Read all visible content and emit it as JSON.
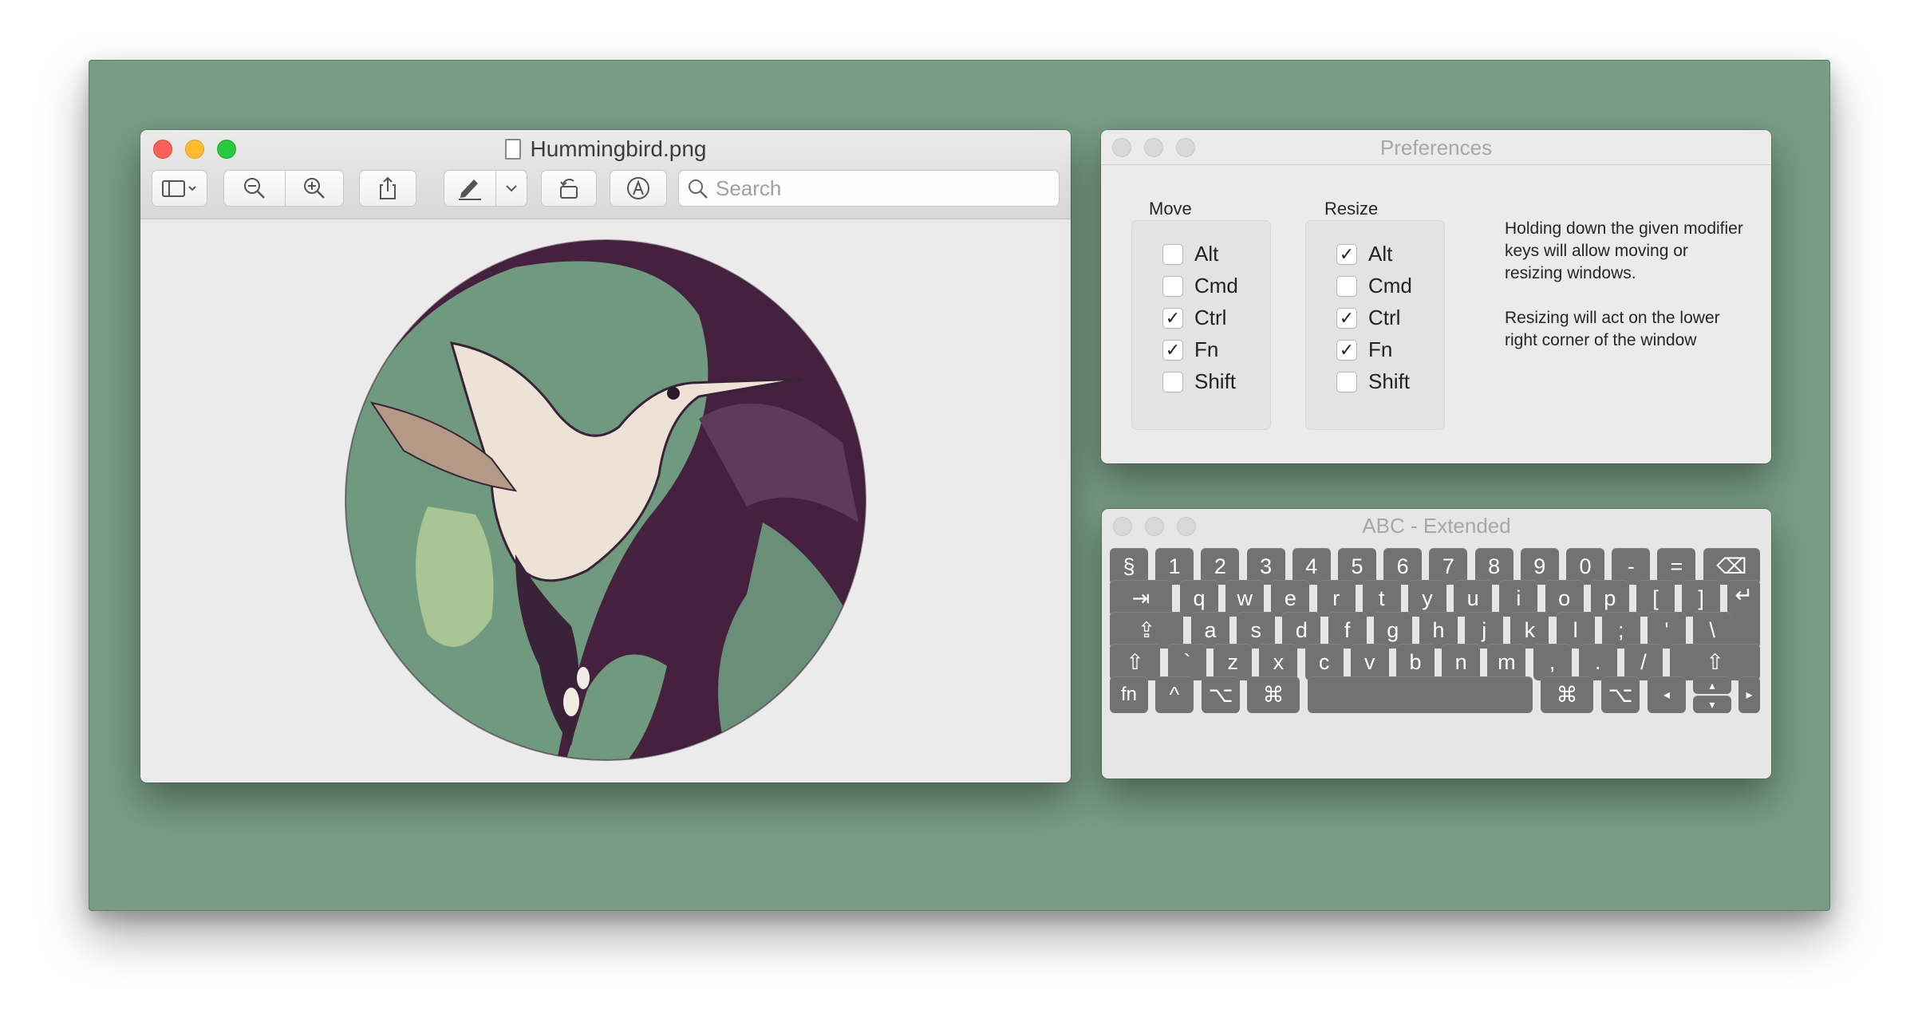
{
  "preview": {
    "title": "Hummingbird.png",
    "search_placeholder": "Search",
    "colors": {
      "disc_dark": "#45213f",
      "disc_green": "#6f9a80",
      "disc_light": "#a9c495",
      "bird_light": "#ece3d6"
    }
  },
  "preferences": {
    "title": "Preferences",
    "move": {
      "label": "Move",
      "options": [
        {
          "label": "Alt",
          "checked": false
        },
        {
          "label": "Cmd",
          "checked": false
        },
        {
          "label": "Ctrl",
          "checked": true
        },
        {
          "label": "Fn",
          "checked": true
        },
        {
          "label": "Shift",
          "checked": false
        }
      ]
    },
    "resize": {
      "label": "Resize",
      "options": [
        {
          "label": "Alt",
          "checked": true
        },
        {
          "label": "Cmd",
          "checked": false
        },
        {
          "label": "Ctrl",
          "checked": true
        },
        {
          "label": "Fn",
          "checked": true
        },
        {
          "label": "Shift",
          "checked": false
        }
      ]
    },
    "description_1": "Holding down the given modifier keys will allow moving or resizing windows.",
    "description_2": "Resizing will act on the lower right corner of the window"
  },
  "keyboard": {
    "title": "ABC - Extended",
    "row1": [
      "§",
      "1",
      "2",
      "3",
      "4",
      "5",
      "6",
      "7",
      "8",
      "9",
      "0",
      "-",
      "=",
      "⌫"
    ],
    "row2": [
      "⇥",
      "q",
      "w",
      "e",
      "r",
      "t",
      "y",
      "u",
      "i",
      "o",
      "p",
      "[",
      "]",
      "↵"
    ],
    "row3": [
      "⇪",
      "a",
      "s",
      "d",
      "f",
      "g",
      "h",
      "j",
      "k",
      "l",
      ";",
      "'",
      "\\"
    ],
    "row4": [
      "⇧",
      "`",
      "z",
      "x",
      "c",
      "v",
      "b",
      "n",
      "m",
      ",",
      ".",
      "/",
      "⇧"
    ],
    "row5": [
      "fn",
      "^",
      "⌥",
      "⌘",
      "",
      "⌘",
      "⌥",
      "◂",
      "▴",
      "▾",
      "▸"
    ]
  },
  "desktop_color": "#789c84"
}
